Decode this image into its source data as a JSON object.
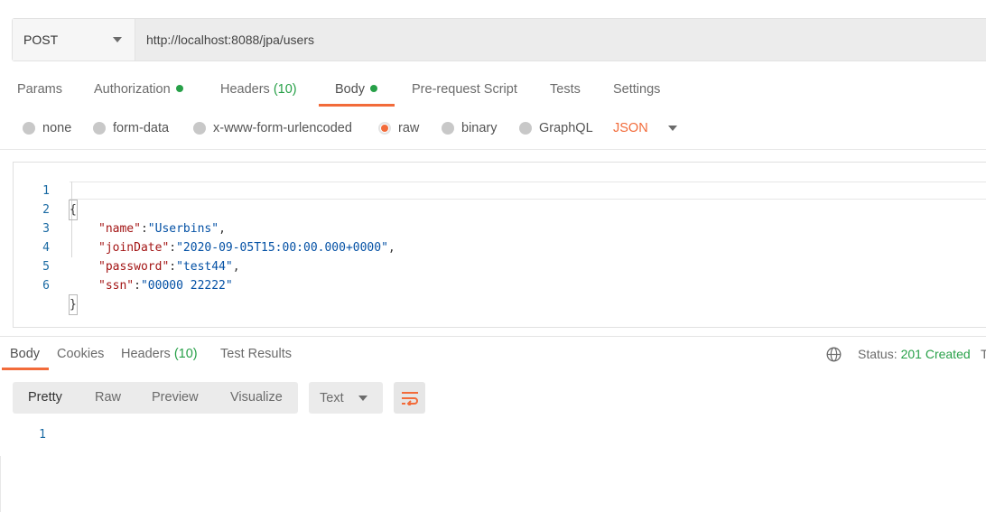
{
  "request": {
    "method": "POST",
    "url": "http://localhost:8088/jpa/users"
  },
  "request_tabs": {
    "params": "Params",
    "authorization": "Authorization",
    "headers": "Headers",
    "headers_count": "(10)",
    "body": "Body",
    "pre_request": "Pre-request Script",
    "tests": "Tests",
    "settings": "Settings"
  },
  "body_types": {
    "none": "none",
    "form_data": "form-data",
    "urlencoded": "x-www-form-urlencoded",
    "raw": "raw",
    "binary": "binary",
    "graphql": "GraphQL",
    "selected": "raw",
    "language": "JSON"
  },
  "editor": {
    "lines": [
      {
        "n": "1",
        "text": "{"
      },
      {
        "n": "2",
        "key": "\"name\"",
        "value": "\"Userbins\"",
        "tail": ","
      },
      {
        "n": "3",
        "key": "\"joinDate\"",
        "value": "\"2020-09-05T15:00:00.000+0000\"",
        "tail": ","
      },
      {
        "n": "4",
        "key": "\"password\"",
        "value": "\"test44\"",
        "tail": ","
      },
      {
        "n": "5",
        "key": "\"ssn\"",
        "value": "\"00000 22222\"",
        "tail": ""
      },
      {
        "n": "6",
        "text": "}"
      }
    ]
  },
  "response_tabs": {
    "body": "Body",
    "cookies": "Cookies",
    "headers": "Headers",
    "headers_count": "(10)",
    "test_results": "Test Results"
  },
  "status": {
    "label": "Status:",
    "value": "201 Created",
    "next_truncated": "T"
  },
  "view_modes": {
    "pretty": "Pretty",
    "raw": "Raw",
    "preview": "Preview",
    "visualize": "Visualize",
    "format": "Text"
  },
  "response_body": {
    "line_numbers": [
      "1"
    ]
  },
  "colors": {
    "accent": "#f26b3a",
    "success": "#27a048",
    "json_key": "#a31515",
    "json_value": "#0451a5"
  }
}
